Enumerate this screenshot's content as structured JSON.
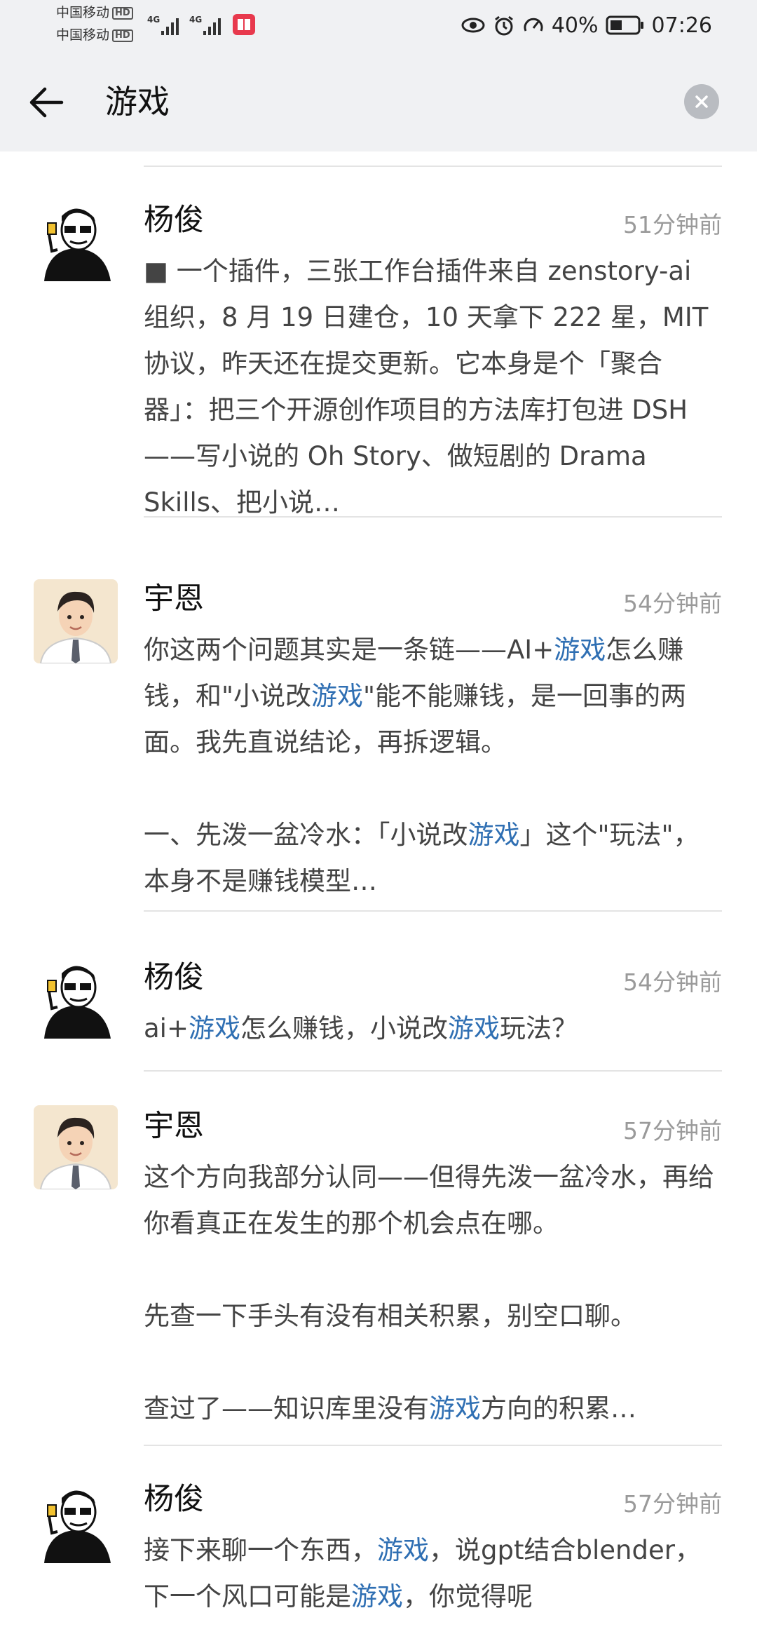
{
  "status_bar": {
    "carrier_1": "中国移动",
    "carrier_2": "中国移动",
    "hd_label": "HD",
    "net_label": "4G",
    "battery": "40%",
    "time": "07:26"
  },
  "header": {
    "search_query": "游戏"
  },
  "results": [
    {
      "sender": "杨俊",
      "avatar": "pixel-art-man-avatar",
      "time": "51分钟前",
      "preview": [
        {
          "text": "■ 一个插件，三张工作台插件来自 zenstory-ai 组织，8 月 19 日建仓，10 天拿下 222 星，MIT 协议，昨天还在提交更新。它本身是个「聚合器」：把三个开源创作项目的方法库打包进 DSH——写小说的 Oh Story、做短剧的 Drama Skills、把小说…"
        }
      ]
    },
    {
      "sender": "宇恩",
      "avatar": "cartoon-young-man-avatar",
      "time": "54分钟前",
      "preview": [
        {
          "text": "你这两个问题其实是一条链——AI+"
        },
        {
          "text": "游戏",
          "hl": true
        },
        {
          "text": "怎么赚钱，和\"小说改"
        },
        {
          "text": "游戏",
          "hl": true
        },
        {
          "text": "\"能不能赚钱，是一回事的两面。我先直说结论，再拆逻辑。\n\n一、先泼一盆冷水：「小说改"
        },
        {
          "text": "游戏",
          "hl": true
        },
        {
          "text": "」这个\"玩法\"，本身不是赚钱模型…"
        }
      ]
    },
    {
      "sender": "杨俊",
      "avatar": "pixel-art-man-avatar",
      "time": "54分钟前",
      "preview": [
        {
          "text": "ai+"
        },
        {
          "text": "游戏",
          "hl": true
        },
        {
          "text": "怎么赚钱，小说改"
        },
        {
          "text": "游戏",
          "hl": true
        },
        {
          "text": "玩法？"
        }
      ]
    },
    {
      "sender": "宇恩",
      "avatar": "cartoon-young-man-avatar",
      "time": "57分钟前",
      "preview": [
        {
          "text": "这个方向我部分认同——但得先泼一盆冷水，再给你看真正在发生的那个机会点在哪。\n\n先查一下手头有没有相关积累，别空口聊。\n\n查过了——知识库里没有"
        },
        {
          "text": "游戏",
          "hl": true
        },
        {
          "text": "方向的积累…"
        }
      ]
    },
    {
      "sender": "杨俊",
      "avatar": "pixel-art-man-avatar",
      "time": "57分钟前",
      "preview": [
        {
          "text": "接下来聊一个东西，"
        },
        {
          "text": "游戏",
          "hl": true
        },
        {
          "text": "，说gpt结合blender，下一个风口可能是"
        },
        {
          "text": "游戏",
          "hl": true
        },
        {
          "text": "，你觉得呢"
        }
      ]
    }
  ],
  "colors": {
    "highlight": "#2f6fb3",
    "header_bg": "#f0f1f3",
    "time_text": "#9a9a9a"
  }
}
